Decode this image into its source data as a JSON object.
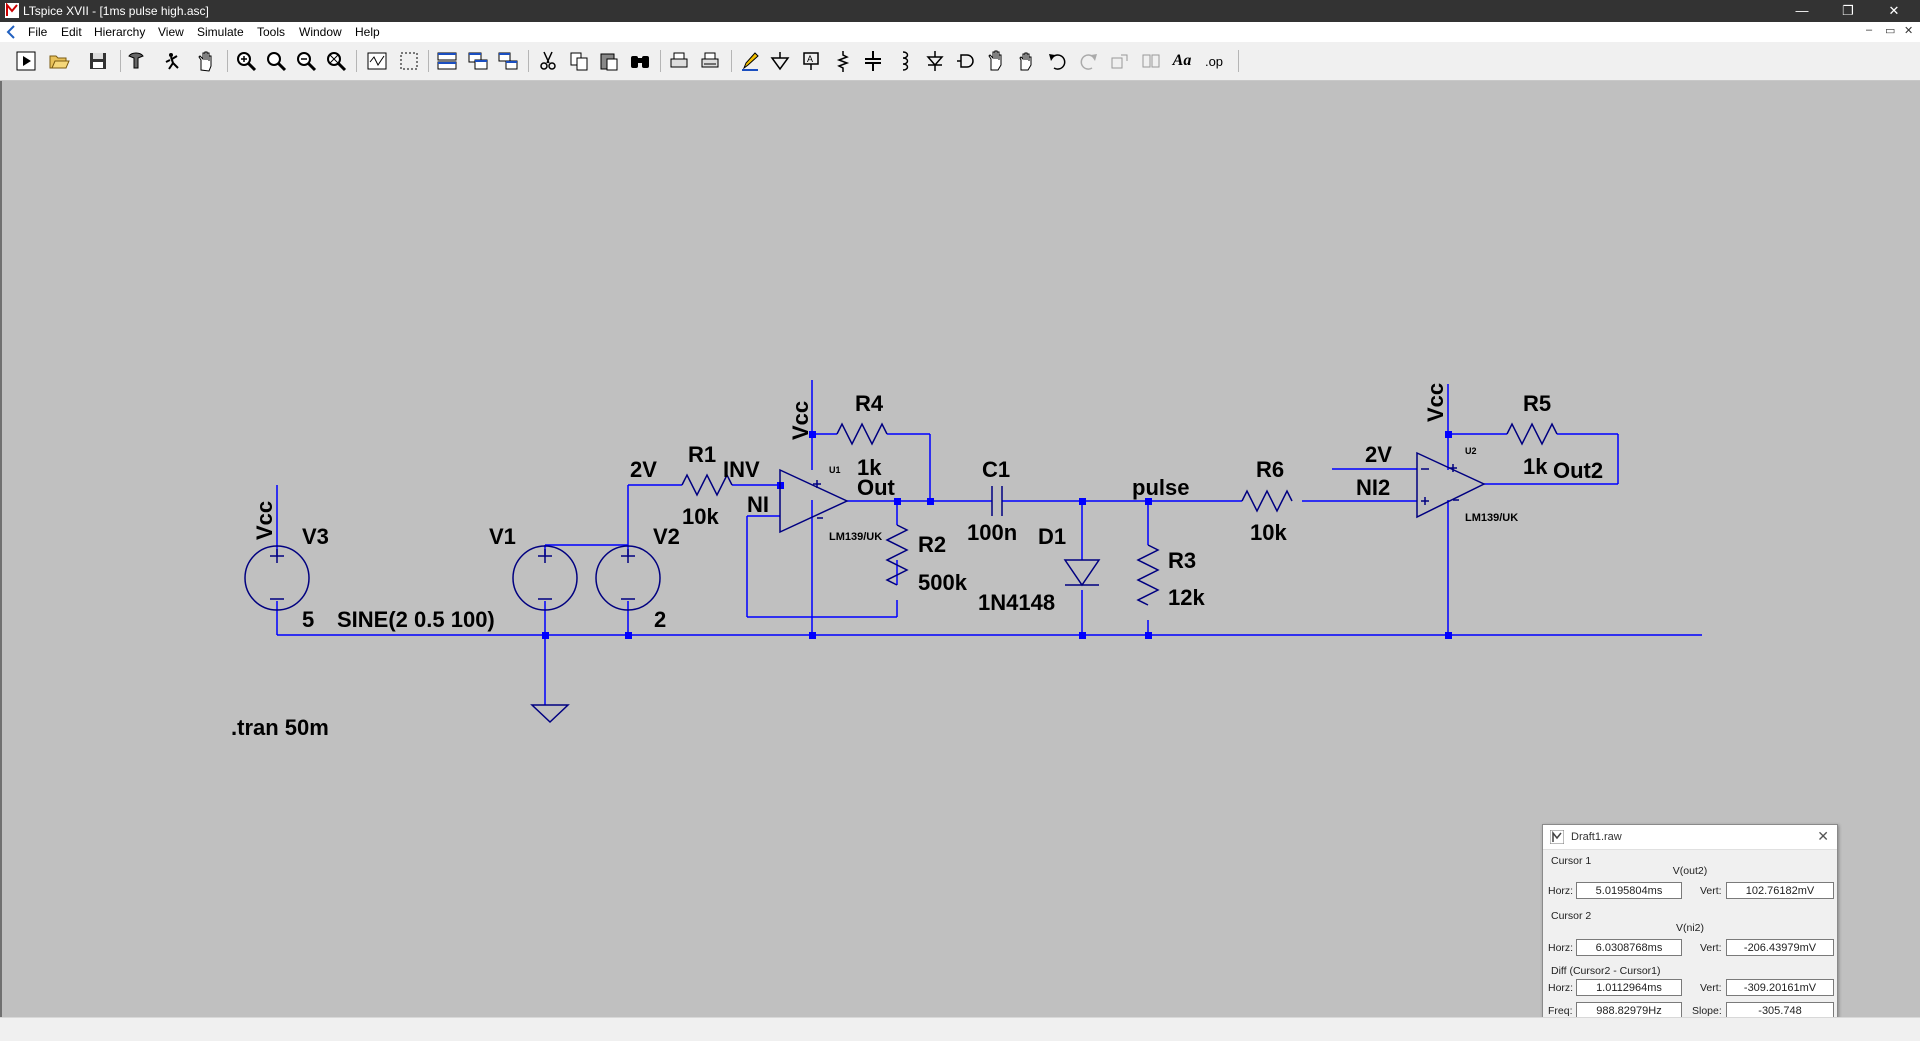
{
  "window": {
    "title": "LTspice XVII - [1ms pulse high.asc]",
    "controls": {
      "minimize": "—",
      "maximize": "❐",
      "close": "✕"
    },
    "mdi_controls": {
      "minimize": "–",
      "restore": "▭",
      "close": "✕"
    }
  },
  "menu": [
    "File",
    "Edit",
    "Hierarchy",
    "View",
    "Simulate",
    "Tools",
    "Window",
    "Help"
  ],
  "toolbar": {
    "icons": [
      "run-icon",
      "open-icon",
      "save-icon",
      "control-panel-icon",
      "halt-icon",
      "pan-icon",
      "zoom-in-icon",
      "zoom-area-icon",
      "zoom-out-icon",
      "zoom-fit-icon",
      "plot-settings-icon",
      "autoscale-icon",
      "tile-horizontal-icon",
      "tile-vertical-icon",
      "cascade-icon",
      "cut-icon",
      "copy-icon",
      "paste-icon",
      "find-icon",
      "print-icon",
      "print-preview-icon",
      "draw-wire-icon",
      "ground-icon",
      "label-net-icon",
      "resistor-icon",
      "capacitor-icon",
      "inductor-icon",
      "diode-icon",
      "component-icon",
      "move-icon",
      "drag-icon",
      "undo-icon",
      "redo-icon",
      "rotate-icon",
      "mirror-icon",
      "text-icon",
      "spice-directive-icon"
    ],
    "text_label": "Aa",
    "op_label": ".op"
  },
  "schematic": {
    "labels": {
      "vcc_v3": "Vcc",
      "v3": "V3",
      "v3_value": "5",
      "v1": "V1",
      "v1_value": "SINE(2 0.5 100)",
      "v2": "V2",
      "v2_value": "2",
      "net_2v_a": "2V",
      "r1": "R1",
      "r1_value": "10k",
      "inv": "INV",
      "ni": "NI",
      "vcc_u1": "Vcc",
      "u1": "U1",
      "u1_model": "LM139/UK",
      "r4": "R4",
      "r4_value": "1k",
      "out": "Out",
      "r2": "R2",
      "r2_value": "500k",
      "c1": "C1",
      "c1_value": "100n",
      "d1": "D1",
      "d1_value": "1N4148",
      "pulse": "pulse",
      "r3": "R3",
      "r3_value": "12k",
      "r6": "R6",
      "r6_value": "10k",
      "net_2v_b": "2V",
      "ni2": "NI2",
      "vcc_u2": "Vcc",
      "u2": "U2",
      "u2_model": "LM139/UK",
      "r5": "R5",
      "r5_value": "1k",
      "out2": "Out2",
      "directive": ".tran 50m"
    },
    "colors": {
      "background": "#c0c0c0",
      "wire": "#0000ff",
      "component": "#000080"
    }
  },
  "cursor_window": {
    "title": "Draft1.raw",
    "cursor1": {
      "label": "Cursor 1",
      "trace": "V(out2)",
      "horz_label": "Horz:",
      "horz": "5.0195804ms",
      "vert_label": "Vert:",
      "vert": "102.76182mV"
    },
    "cursor2": {
      "label": "Cursor 2",
      "trace": "V(ni2)",
      "horz_label": "Horz:",
      "horz": "6.0308768ms",
      "vert_label": "Vert:",
      "vert": "-206.43979mV"
    },
    "diff": {
      "label": "Diff (Cursor2 - Cursor1)",
      "horz_label": "Horz:",
      "horz": "1.0112964ms",
      "vert_label": "Vert:",
      "vert": "-309.20161mV",
      "freq_label": "Freq:",
      "freq": "988.82979Hz",
      "slope_label": "Slope:",
      "slope": "-305.748"
    }
  }
}
